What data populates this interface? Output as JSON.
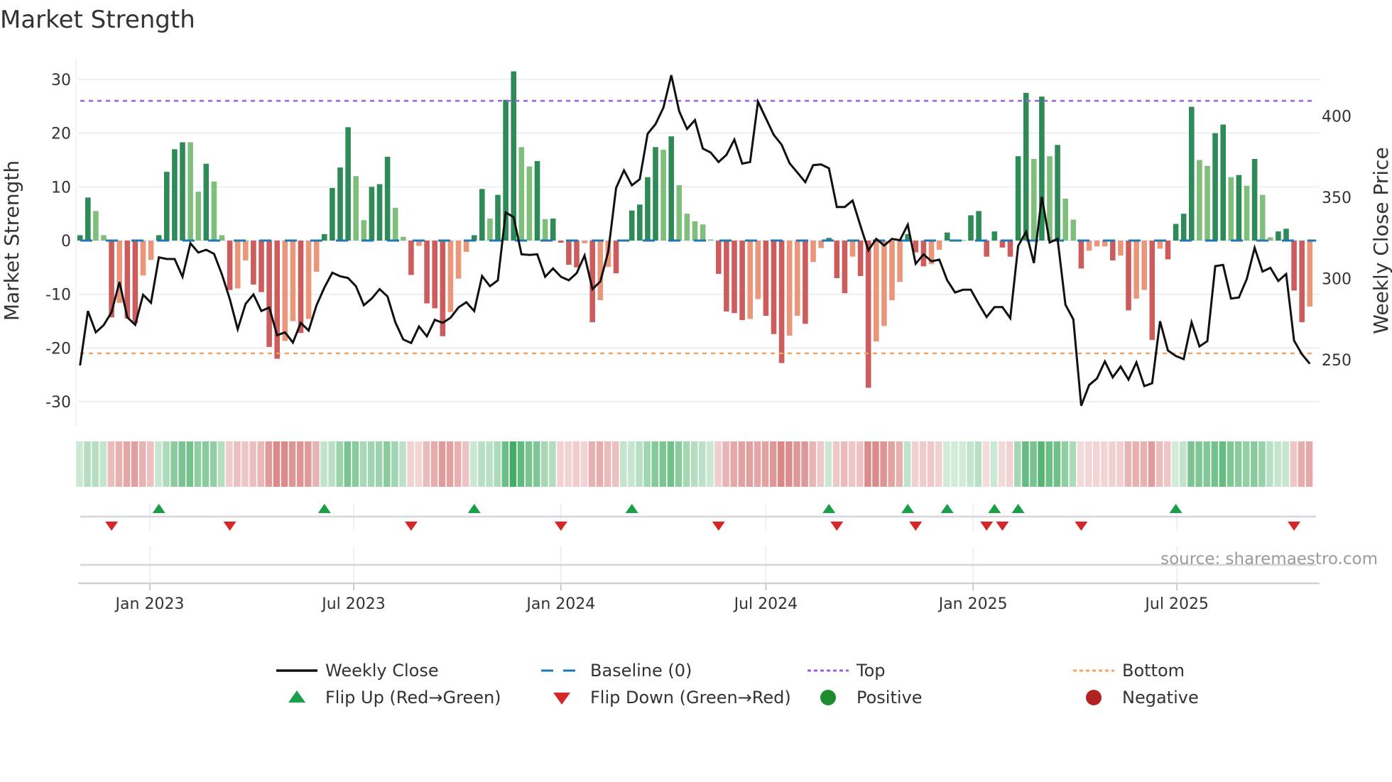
{
  "chart_data": {
    "type": "bar",
    "title": "Market Strength",
    "ylabel": "Market Strength",
    "y2label": "Weekly Close Price",
    "ylim": [
      -34,
      35
    ],
    "y2lim": [
      216,
      430
    ],
    "yticks": [
      -30,
      -20,
      -10,
      0,
      10,
      20,
      30
    ],
    "y2ticks": [
      250,
      300,
      350,
      400
    ],
    "frequency": "weekly",
    "start_date": "2022-10-31",
    "xticks": [
      {
        "label": "Jan 2023",
        "date": "2023-01-01"
      },
      {
        "label": "Jul 2023",
        "date": "2023-07-01"
      },
      {
        "label": "Jan 2024",
        "date": "2024-01-01"
      },
      {
        "label": "Jul 2024",
        "date": "2024-07-01"
      },
      {
        "label": "Jan 2025",
        "date": "2025-01-01"
      },
      {
        "label": "Jul 2025",
        "date": "2025-07-01"
      }
    ],
    "top_level": 26,
    "bottom_level": -21,
    "baseline": 0,
    "strength": [
      1,
      8,
      5.5,
      1,
      -14.3,
      -11.6,
      -14.5,
      -15.4,
      -6.5,
      -3.6,
      1,
      12.8,
      17,
      18.3,
      18.3,
      9.1,
      14.3,
      11,
      1,
      -9.2,
      -8.9,
      -3.7,
      -8.2,
      -9.6,
      -19.8,
      -22,
      -18.7,
      -15,
      -17.2,
      -14.6,
      -5.8,
      1.2,
      9.8,
      13.6,
      21.1,
      12,
      3.8,
      10,
      10.5,
      15.6,
      6.1,
      0.7,
      -6.4,
      -1,
      -11.7,
      -12.6,
      -17.8,
      -13.3,
      -7.1,
      -2.1,
      1,
      9.6,
      4.1,
      8.5,
      26.2,
      31.5,
      17.4,
      13.8,
      14.8,
      4,
      4.1,
      -0.4,
      -4.5,
      -5,
      -0.5,
      -15.2,
      -11.1,
      -4.9,
      -6.1,
      0,
      5.6,
      6.7,
      11.8,
      17.4,
      16.9,
      19.4,
      10.3,
      5,
      3.6,
      3,
      0.2,
      -6.2,
      -13.2,
      -13.5,
      -14.8,
      -14.6,
      -10.9,
      -14,
      -17.4,
      -22.8,
      -17.7,
      -14,
      -15.5,
      -4,
      -1.4,
      0.5,
      -7,
      -9.8,
      -3,
      -6.6,
      -27.4,
      -18.8,
      -15.9,
      -11.1,
      -7.7,
      1.2,
      -2.2,
      -4.8,
      -4.4,
      -1.7,
      1.5,
      0.2,
      0.1,
      4.7,
      5.5,
      -3,
      1.7,
      -1.3,
      -3,
      15.7,
      27.5,
      15.2,
      26.8,
      15.7,
      17.8,
      7.8,
      3.9,
      -5.2,
      -1.9,
      -1.1,
      -1.1,
      -3.7,
      -2.8,
      -13,
      -10.8,
      -9.2,
      -18.5,
      -1.5,
      -3.5,
      3.1,
      5,
      24.9,
      15,
      13.9,
      20,
      21.6,
      11.8,
      12.2,
      10.2,
      15.2,
      8.5,
      0.6,
      1.7,
      2.2,
      -9.3,
      -15.2,
      -12.3
    ],
    "shade": "DDLLDLDDLLDDDDLLDLLDLLDDDDLLDLLDDDDLLDDDLLDLDDDLLLDDLDDDLLDLDDDDLDLLDDDDDDLDLLLLLDDDDLLDDDLLDLLDDDLDDLLLLDDDLLDLLDDDDDDDDLDLDLLDLLLDLDLLDLDDDDLLDDLDLDLLDDDDL",
    "weekly_close": [
      246.5,
      280,
      266.9,
      271.3,
      279.3,
      297.9,
      276.1,
      271.5,
      290,
      285.1,
      313,
      312,
      312,
      301.1,
      321.7,
      316,
      317.7,
      315.2,
      302.5,
      287.3,
      268.8,
      284.4,
      290.2,
      280,
      282.2,
      265.1,
      266.9,
      260.6,
      272.7,
      268,
      283.6,
      294.5,
      303.6,
      301.4,
      300.3,
      295.3,
      283.6,
      287.7,
      293.5,
      289,
      273,
      262.5,
      260.3,
      270.5,
      264.4,
      274.6,
      272.7,
      275.9,
      282.2,
      285.4,
      280,
      301.5,
      295.3,
      298.9,
      340.7,
      337.8,
      314.9,
      314.5,
      314.9,
      301.1,
      306.2,
      301.1,
      298.9,
      303.3,
      314.2,
      293.5,
      298.2,
      316.4,
      355.7,
      366.6,
      357.4,
      361.1,
      389.1,
      395,
      405.1,
      425.1,
      403,
      392,
      397.5,
      380,
      377.5,
      371.7,
      376.1,
      385.5,
      370.7,
      371.7,
      408.8,
      398.6,
      388.4,
      382.3,
      371,
      365.2,
      359.3,
      369.8,
      370.2,
      367.8,
      344,
      344,
      348,
      332.4,
      317.4,
      324.4,
      320.3,
      324.4,
      323.6,
      333.1,
      309.1,
      314.9,
      310.6,
      311.6,
      298.9,
      291.4,
      293.1,
      293.1,
      284.4,
      276.3,
      282.4,
      282.4,
      275.6,
      320,
      328.7,
      309.5,
      350.3,
      322.2,
      324.4,
      283.9,
      274.9,
      221.7,
      234.4,
      238.5,
      249,
      239.2,
      245.8,
      237.8,
      248.4,
      233.8,
      235.6,
      273.7,
      255.7,
      252.3,
      250.4,
      273.1,
      258.2,
      261.5,
      307.6,
      308.4,
      287.7,
      288.3,
      299.7,
      318.9,
      304.3,
      306.6,
      298.5,
      302.8,
      261.8,
      253.4,
      247.5
    ],
    "flip_up_weeks": [
      10,
      31,
      50,
      70,
      95,
      105,
      110,
      116,
      119,
      139
    ],
    "flip_down_weeks": [
      4,
      19,
      42,
      61,
      81,
      96,
      106,
      115,
      117,
      127,
      154
    ],
    "legend": [
      {
        "label": "Weekly Close",
        "symbol": "line",
        "color": "#111111"
      },
      {
        "label": "Baseline (0)",
        "symbol": "dash",
        "color": "#1f77b4"
      },
      {
        "label": "Top",
        "symbol": "dot",
        "color": "#9b5de5"
      },
      {
        "label": "Bottom",
        "symbol": "dot",
        "color": "#f4a261"
      },
      {
        "label": "Flip Up (Red→Green)",
        "symbol": "triangle-up",
        "color": "#1a9e48"
      },
      {
        "label": "Flip Down (Green→Red)",
        "symbol": "triangle-down",
        "color": "#d62728"
      },
      {
        "label": "Positive",
        "symbol": "circle",
        "color": "#1e8c2e"
      },
      {
        "label": "Negative",
        "symbol": "circle",
        "color": "#b22222"
      }
    ],
    "legend_placement": "bottom",
    "colors": {
      "pos_dark": "#2e8b57",
      "pos_light": "#7fbf7b",
      "neg_dark": "#cd5c5c",
      "neg_light": "#e9967a",
      "heat_pos": "#31a354",
      "heat_neg": "#cd5c5c",
      "grid": "#eceff4"
    }
  },
  "source": "source: sharemaestro.com"
}
